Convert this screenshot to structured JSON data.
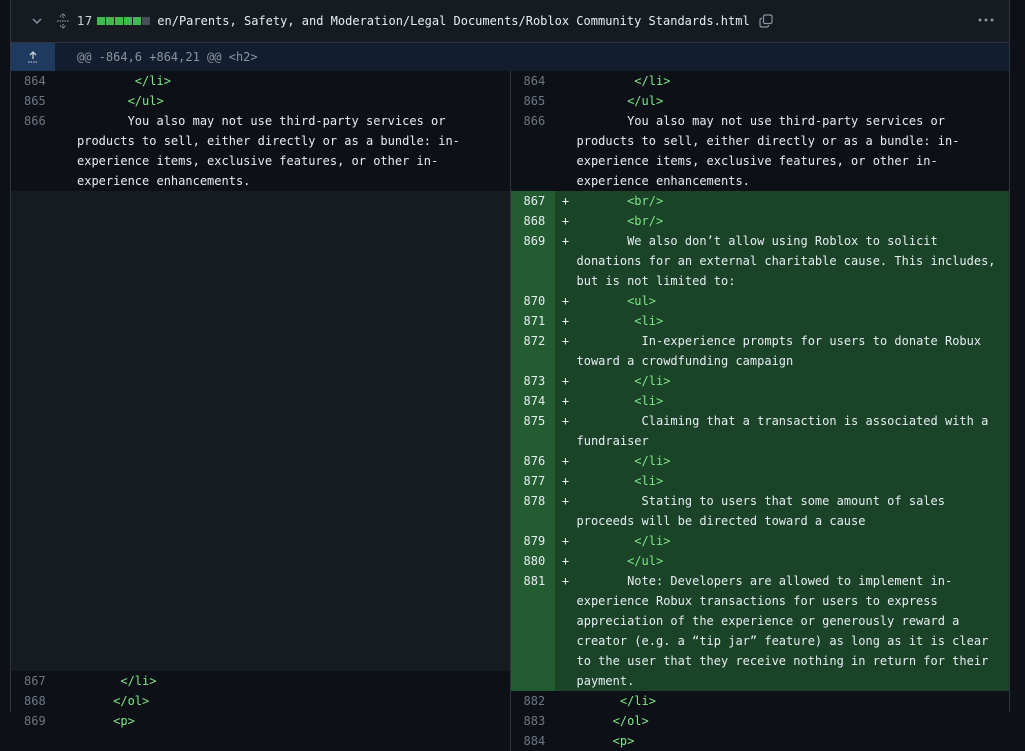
{
  "file": {
    "changes": "17",
    "path": "en/Parents, Safety, and Moderation/Legal Documents/Roblox Community Standards.html",
    "diffstat_colors": [
      "#3fb950",
      "#3fb950",
      "#3fb950",
      "#3fb950",
      "#3fb950",
      "#484f58"
    ]
  },
  "hunk": {
    "header": "@@ -864,6 +864,21 @@ <h2>"
  },
  "left_top": [
    {
      "num": "864",
      "indent": "        ",
      "pre": "",
      "tag": "</li>",
      "post": ""
    },
    {
      "num": "865",
      "indent": "       ",
      "pre": "",
      "tag": "</ul>",
      "post": ""
    },
    {
      "num": "866",
      "indent": "",
      "pre": "       You also may not use third-party services or products to sell, either directly or as a bundle: in-experience items, exclusive features, or other in-experience enhancements.",
      "tag": "",
      "post": ""
    }
  ],
  "right_top": [
    {
      "num": "864",
      "indent": "        ",
      "pre": "",
      "tag": "</li>",
      "post": ""
    },
    {
      "num": "865",
      "indent": "       ",
      "pre": "",
      "tag": "</ul>",
      "post": ""
    },
    {
      "num": "866",
      "indent": "",
      "pre": "       You also may not use third-party services or products to sell, either directly or as a bundle: in-experience items, exclusive features, or other in-experience enhancements.",
      "tag": "",
      "post": ""
    }
  ],
  "added": [
    {
      "num": "867",
      "mark": "+",
      "indent": "       ",
      "pre": "",
      "tag": "<br/>",
      "post": ""
    },
    {
      "num": "868",
      "mark": "+",
      "indent": "       ",
      "pre": "",
      "tag": "<br/>",
      "post": ""
    },
    {
      "num": "869",
      "mark": "+",
      "indent": "",
      "pre": "       We also don’t allow using Roblox to solicit donations for an external charitable cause. This includes, but is not limited to:",
      "tag": "",
      "post": "",
      "rows": 3
    },
    {
      "num": "870",
      "mark": "+",
      "indent": "       ",
      "pre": "",
      "tag": "<ul>",
      "post": ""
    },
    {
      "num": "871",
      "mark": "+",
      "indent": "        ",
      "pre": "",
      "tag": "<li>",
      "post": ""
    },
    {
      "num": "872",
      "mark": "+",
      "indent": "",
      "pre": "         In-experience prompts for users to donate Robux toward a crowdfunding campaign",
      "tag": "",
      "post": "",
      "rows": 2
    },
    {
      "num": "873",
      "mark": "+",
      "indent": "        ",
      "pre": "",
      "tag": "</li>",
      "post": ""
    },
    {
      "num": "874",
      "mark": "+",
      "indent": "        ",
      "pre": "",
      "tag": "<li>",
      "post": ""
    },
    {
      "num": "875",
      "mark": "+",
      "indent": "",
      "pre": "         Claiming that a transaction is associated with a fundraiser",
      "tag": "",
      "post": "",
      "rows": 2
    },
    {
      "num": "876",
      "mark": "+",
      "indent": "        ",
      "pre": "",
      "tag": "</li>",
      "post": ""
    },
    {
      "num": "877",
      "mark": "+",
      "indent": "        ",
      "pre": "",
      "tag": "<li>",
      "post": ""
    },
    {
      "num": "878",
      "mark": "+",
      "indent": "",
      "pre": "         Stating to users that some amount of sales proceeds will be directed toward a cause",
      "tag": "",
      "post": "",
      "rows": 2
    },
    {
      "num": "879",
      "mark": "+",
      "indent": "        ",
      "pre": "",
      "tag": "</li>",
      "post": ""
    },
    {
      "num": "880",
      "mark": "+",
      "indent": "       ",
      "pre": "",
      "tag": "</ul>",
      "post": ""
    },
    {
      "num": "881",
      "mark": "+",
      "indent": "",
      "pre": "       Note: Developers are allowed to implement in-experience Robux transactions for users to express appreciation of the experience or generously reward a creator (e.g. a “tip jar” feature) as long as it is clear to the user that they receive nothing in return for their payment.",
      "tag": "",
      "post": "",
      "rows": 5
    }
  ],
  "left_bottom": [
    {
      "num": "867",
      "indent": "      ",
      "pre": "",
      "tag": "</li>",
      "post": ""
    },
    {
      "num": "868",
      "indent": "     ",
      "pre": "",
      "tag": "</ol>",
      "post": ""
    },
    {
      "num": "869",
      "indent": "     ",
      "pre": "",
      "tag": "<p>",
      "post": ""
    }
  ],
  "right_bottom": [
    {
      "num": "882",
      "indent": "      ",
      "pre": "",
      "tag": "</li>",
      "post": ""
    },
    {
      "num": "883",
      "indent": "     ",
      "pre": "",
      "tag": "</ol>",
      "post": ""
    },
    {
      "num": "884",
      "indent": "     ",
      "pre": "",
      "tag": "<p>",
      "post": ""
    }
  ]
}
